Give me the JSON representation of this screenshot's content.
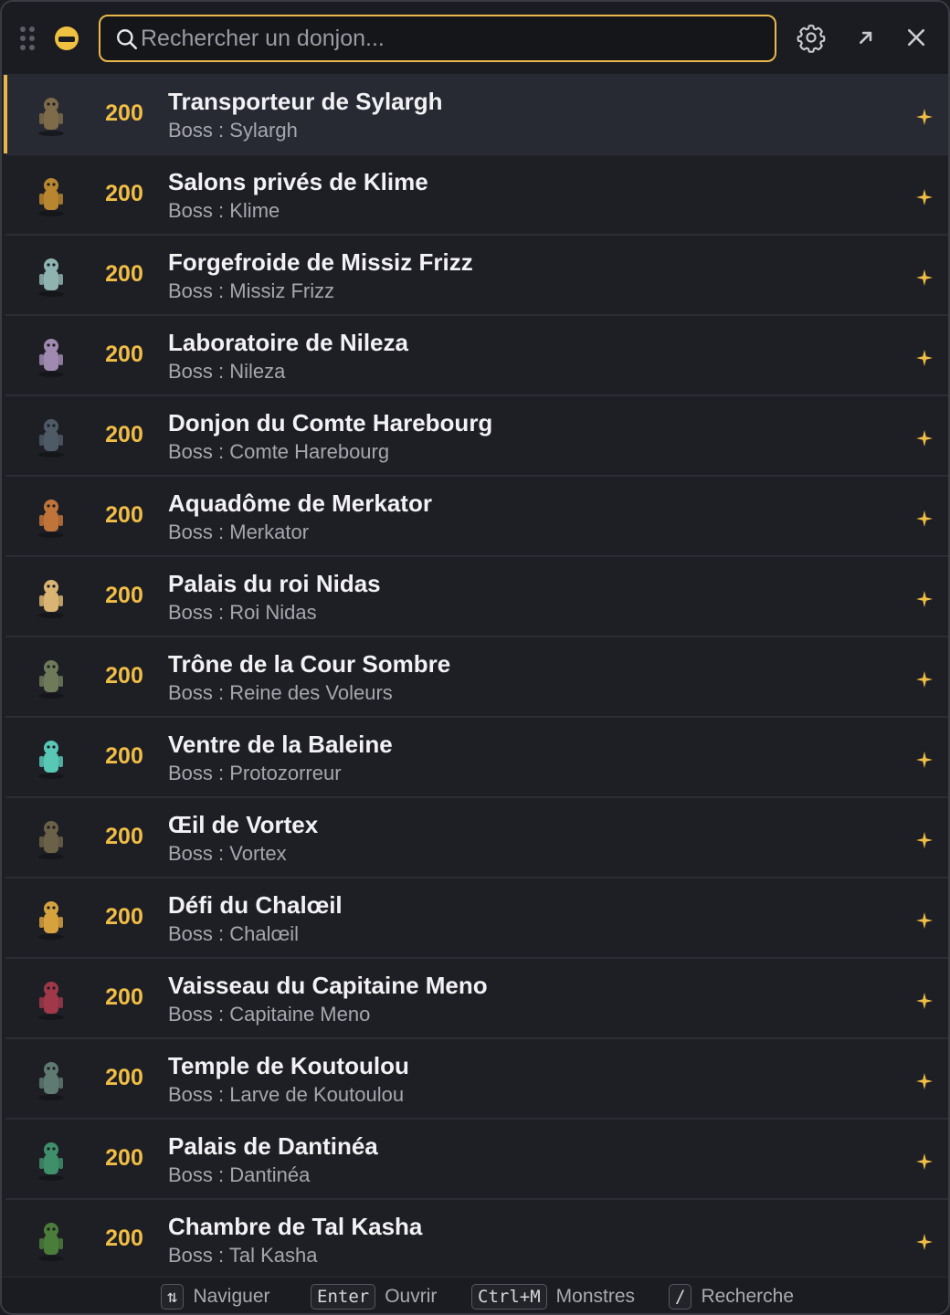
{
  "header": {
    "search_placeholder": "Rechercher un donjon...",
    "icons": [
      "drag-handle-icon",
      "app-logo-icon",
      "search-icon",
      "gear-icon",
      "popout-icon",
      "close-icon"
    ]
  },
  "colors": {
    "accent": "#e8b94a",
    "level": "#f0bd45",
    "background": "#1e1f25",
    "selected_row": "#272a33"
  },
  "dungeons": [
    {
      "level": "200",
      "name": "Transporteur de Sylargh",
      "boss": "Boss : Sylargh",
      "avatar": "#7d6b4a"
    },
    {
      "level": "200",
      "name": "Salons privés de Klime",
      "boss": "Boss : Klime",
      "avatar": "#b8862e"
    },
    {
      "level": "200",
      "name": "Forgefroide de Missiz Frizz",
      "boss": "Boss : Missiz Frizz",
      "avatar": "#8fb3b0"
    },
    {
      "level": "200",
      "name": "Laboratoire de Nileza",
      "boss": "Boss : Nileza",
      "avatar": "#a08ab0"
    },
    {
      "level": "200",
      "name": "Donjon du Comte Harebourg",
      "boss": "Boss : Comte Harebourg",
      "avatar": "#4e5a66"
    },
    {
      "level": "200",
      "name": "Aquadôme de Merkator",
      "boss": "Boss : Merkator",
      "avatar": "#c0743a"
    },
    {
      "level": "200",
      "name": "Palais du roi Nidas",
      "boss": "Boss : Roi Nidas",
      "avatar": "#d9b472"
    },
    {
      "level": "200",
      "name": "Trône de la Cour Sombre",
      "boss": "Boss : Reine des Voleurs",
      "avatar": "#6e7a5a"
    },
    {
      "level": "200",
      "name": "Ventre de la Baleine",
      "boss": "Boss : Protozorreur",
      "avatar": "#58c7b5"
    },
    {
      "level": "200",
      "name": "Œil de Vortex",
      "boss": "Boss : Vortex",
      "avatar": "#6a6148"
    },
    {
      "level": "200",
      "name": "Défi du Chalœil",
      "boss": "Boss : Chalœil",
      "avatar": "#d5a23e"
    },
    {
      "level": "200",
      "name": "Vaisseau du Capitaine Meno",
      "boss": "Boss : Capitaine Meno",
      "avatar": "#a0384a"
    },
    {
      "level": "200",
      "name": "Temple de Koutoulou",
      "boss": "Boss : Larve de Koutoulou",
      "avatar": "#5f7a70"
    },
    {
      "level": "200",
      "name": "Palais de Dantinéa",
      "boss": "Boss : Dantinéa",
      "avatar": "#3f8f6a"
    },
    {
      "level": "200",
      "name": "Chambre de Tal Kasha",
      "boss": "Boss : Tal Kasha",
      "avatar": "#4b7d3a"
    }
  ],
  "footer": {
    "hints": [
      {
        "key": "⇅",
        "label": "Naviguer"
      },
      {
        "key": "Enter",
        "label": "Ouvrir"
      },
      {
        "key": "Ctrl+M",
        "label": "Monstres"
      },
      {
        "key": "/",
        "label": "Recherche"
      }
    ]
  }
}
